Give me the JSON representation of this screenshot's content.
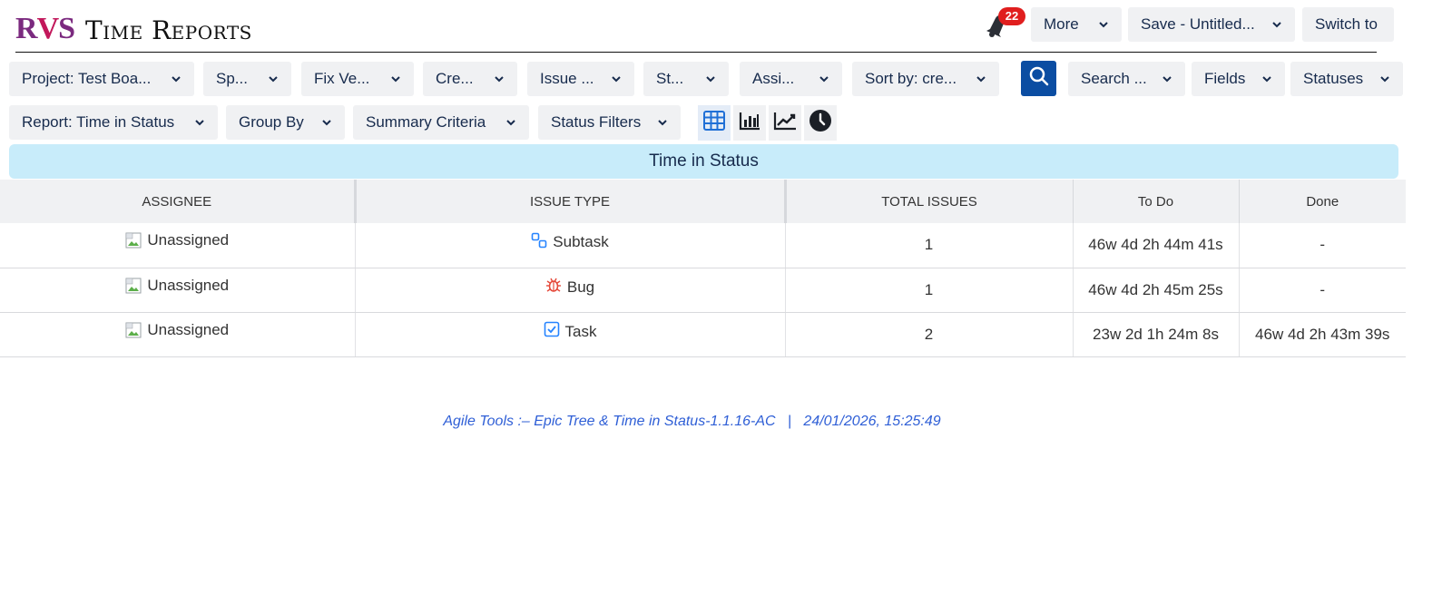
{
  "header": {
    "logo_text": "RVS",
    "app_title": "Time Reports",
    "notification_count": "22",
    "more_label": "More",
    "save_label": "Save - Untitled...",
    "switch_label": "Switch to"
  },
  "filters": {
    "project": "Project: Test Boa...",
    "sprint": "Sp...",
    "fix_version": "Fix Ve...",
    "created": "Cre...",
    "issue_type": "Issue ...",
    "status": "St...",
    "assignee": "Assi...",
    "sort_by": "Sort by: cre...",
    "search": "Search ...",
    "fields": "Fields",
    "statuses": "Statuses"
  },
  "report_bar": {
    "report": "Report: Time in Status",
    "group_by": "Group By",
    "summary_criteria": "Summary Criteria",
    "status_filters": "Status Filters",
    "view_icons": [
      "table-view-icon",
      "bar-chart-icon",
      "line-chart-icon",
      "clock-icon"
    ]
  },
  "report_title": "Time in Status",
  "table": {
    "columns": [
      "ASSIGNEE",
      "ISSUE TYPE",
      "TOTAL ISSUES",
      "To Do",
      "Done"
    ],
    "rows": [
      {
        "assignee": "Unassigned",
        "issue_type": "Subtask",
        "type_icon": "subtask-icon",
        "total": "1",
        "todo": "46w 4d 2h 44m 41s",
        "done": "-"
      },
      {
        "assignee": "Unassigned",
        "issue_type": "Bug",
        "type_icon": "bug-icon",
        "total": "1",
        "todo": "46w 4d 2h 45m 25s",
        "done": "-"
      },
      {
        "assignee": "Unassigned",
        "issue_type": "Task",
        "type_icon": "task-icon",
        "total": "2",
        "todo": "23w 2d 1h 24m 8s",
        "done": "46w 4d 2h 43m 39s"
      }
    ]
  },
  "footer": {
    "product": "Agile Tools :– Epic Tree & Time in Status-1.1.16-AC",
    "separator": "|",
    "timestamp": "24/01/2026, 15:25:49"
  },
  "colors": {
    "primary": "#0b4da2",
    "badge": "#e01e1e",
    "title_bar": "#c8ecfa",
    "footer_link": "#2f5fd6"
  }
}
